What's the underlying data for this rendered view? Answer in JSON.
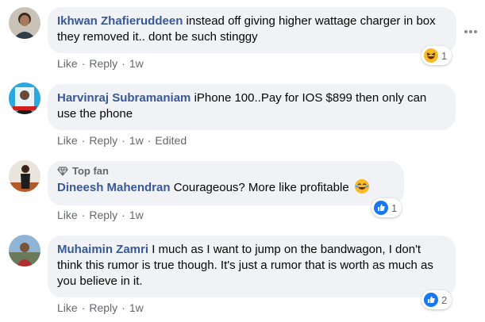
{
  "comments": [
    {
      "author": "Ikhwan Zhafieruddeen",
      "text": "instead off giving higher wattage charger in box they removed it.. dont be such stinggy",
      "actions": {
        "like": "Like",
        "reply": "Reply",
        "time": "1w"
      },
      "reaction": {
        "icon": "haha-reaction-icon",
        "count": "1"
      }
    },
    {
      "author": "Harvinraj Subramaniam",
      "text": "iPhone 100..Pay for IOS $899 then only can use the phone",
      "actions": {
        "like": "Like",
        "reply": "Reply",
        "time": "1w",
        "edited": "Edited"
      }
    },
    {
      "badge": "Top fan",
      "author": "Dineesh Mahendran",
      "text": "Courageous? More like profitable",
      "actions": {
        "like": "Like",
        "reply": "Reply",
        "time": "1w"
      },
      "reaction": {
        "icon": "like-reaction-icon",
        "count": "1"
      }
    },
    {
      "author": "Muhaimin Zamri",
      "text": "I much as I want to jump on the bandwagon, I don't think this rumor is true though. It's just a rumor that is worth as much as you believe in it.",
      "actions": {
        "like": "Like",
        "reply": "Reply",
        "time": "1w"
      },
      "reaction": {
        "icon": "like-reaction-icon",
        "count": "2"
      }
    }
  ],
  "colors": {
    "author": "#385898",
    "bubble": "#f0f2f5",
    "meta": "#65676b",
    "like_blue": "#1877f2",
    "haha_yellow": "#f7b928"
  }
}
